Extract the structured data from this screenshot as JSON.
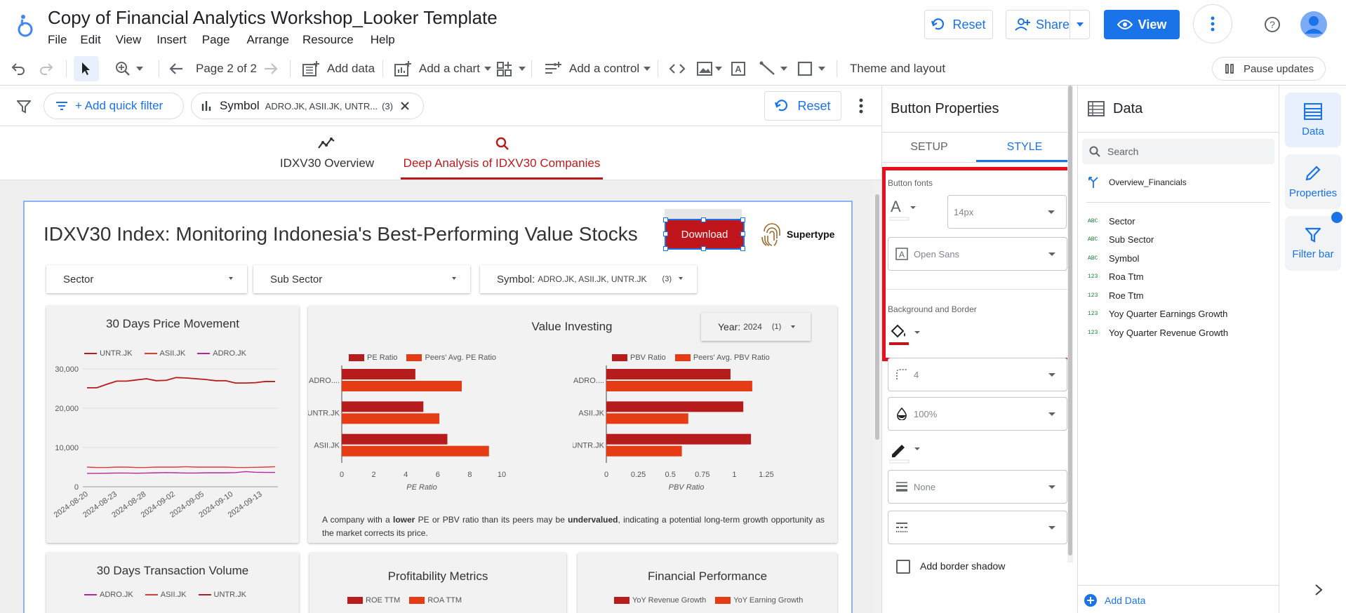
{
  "header": {
    "title": "Copy of Financial Analytics Workshop_Looker Template",
    "menu": [
      "File",
      "Edit",
      "View",
      "Insert",
      "Page",
      "Arrange",
      "Resource",
      "Help"
    ],
    "reset_label": "Reset",
    "share_label": "Share",
    "view_label": "View"
  },
  "toolbar": {
    "page_label": "Page 2 of 2",
    "add_data": "Add data",
    "add_chart": "Add a chart",
    "add_control": "Add a control",
    "theme": "Theme and layout",
    "pause": "Pause updates"
  },
  "filterbar": {
    "add_quick_filter": "+ Add quick filter",
    "chip_field": "Symbol",
    "chip_values": "ADRO.JK, ASII.JK, UNTR...",
    "chip_count": "(3)",
    "reset_label": "Reset"
  },
  "page_tabs": [
    {
      "label": "IDXV30 Overview",
      "active": false
    },
    {
      "label": "Deep Analysis of IDXV30 Companies",
      "active": true
    }
  ],
  "report": {
    "title": "IDXV30 Index: Monitoring Indonesia's Best-Performing Value Stocks",
    "download_label": "Download",
    "logo_text": "Supertype",
    "controls": {
      "sector": "Sector",
      "sub_sector": "Sub Sector",
      "symbol_label": "Symbol:",
      "symbol_values": "ADRO.JK, ASII.JK, UNTR.JK",
      "symbol_count": "(3)",
      "year_label": "Year:",
      "year_value": "2024",
      "year_count": "(1)"
    },
    "note_pre": "A company with a ",
    "note_b1": "lower",
    "note_mid": " PE or PBV ratio than its peers may be ",
    "note_b2": "undervalued",
    "note_post": ", indicating a potential long-term growth opportunity as the market corrects its price.",
    "bottom_cards": {
      "transaction_title": "30 Days Transaction Volume",
      "transaction_legend": [
        "ADRO.JK",
        "ASII.JK",
        "UNTR.JK"
      ],
      "profit_title": "Profitability Metrics",
      "profit_legend": [
        "ROE TTM",
        "ROA TTM"
      ],
      "fin_title": "Financial Performance",
      "fin_legend": [
        "YoY Revenue Growth",
        "YoY Earning Growth"
      ]
    }
  },
  "chart_data": [
    {
      "type": "line",
      "title": "30 Days Price Movement",
      "x": [
        "2024-08-20",
        "2024-08-23",
        "2024-08-28",
        "2024-09-02",
        "2024-09-05",
        "2024-09-10",
        "2024-09-13"
      ],
      "x_ticks": [
        "2024-08-20",
        "2024-08-23",
        "2024-08-28",
        "2024-09-02",
        "2024-09-05",
        "2024-09-10",
        "2024-09-13"
      ],
      "ylim": [
        0,
        30000
      ],
      "y_ticks": [
        "0",
        "10,000",
        "20,000",
        "30,000"
      ],
      "series": [
        {
          "name": "UNTR.JK",
          "color": "#b71c1c",
          "values": [
            25200,
            25200,
            26100,
            26900,
            26900,
            27200,
            27500,
            27000,
            27100,
            27800,
            27700,
            27500,
            27300,
            27000,
            27000,
            26400,
            26400,
            26500,
            26800,
            26800
          ]
        },
        {
          "name": "ASII.JK",
          "color": "#e53935",
          "values": [
            5000,
            4900,
            4900,
            5000,
            5000,
            4900,
            4900,
            5000,
            5000,
            5000,
            5100,
            5000,
            5000,
            5000,
            5000,
            4900,
            4900,
            4950,
            5000,
            5100
          ]
        },
        {
          "name": "ADRO.JK",
          "color": "#b5289c",
          "values": [
            3400,
            3400,
            3450,
            3500,
            3500,
            3450,
            3500,
            3550,
            3600,
            3550,
            3500,
            3500,
            3550,
            3550,
            3550,
            3600,
            3850,
            3700,
            3650,
            3650
          ]
        }
      ]
    },
    {
      "type": "bar",
      "title": "Value Investing",
      "orientation": "horizontal",
      "categories": [
        "ADRO....",
        "UNTR.JK",
        "ASII.JK"
      ],
      "xlabel": "PE Ratio",
      "xlim": [
        0,
        10
      ],
      "x_ticks": [
        "0",
        "2",
        "4",
        "6",
        "8",
        "10"
      ],
      "series": [
        {
          "name": "PE Ratio",
          "color": "#b71c1c",
          "values": [
            4.6,
            5.1,
            6.6
          ]
        },
        {
          "name": "Peers' Avg. PE Ratio",
          "color": "#e53c16",
          "values": [
            7.5,
            6.1,
            9.2
          ]
        }
      ]
    },
    {
      "type": "bar",
      "orientation": "horizontal",
      "categories": [
        "ADRO....",
        "ASII.JK",
        "UNTR.JK"
      ],
      "xlabel": "PBV Ratio",
      "xlim": [
        0,
        1.25
      ],
      "x_ticks": [
        "0",
        "0.25",
        "0.5",
        "0.75",
        "1",
        "1.25"
      ],
      "series": [
        {
          "name": "PBV Ratio",
          "color": "#b71c1c",
          "values": [
            0.97,
            1.07,
            1.13
          ]
        },
        {
          "name": "Peers' Avg. PBV Ratio",
          "color": "#e53c16",
          "values": [
            1.14,
            0.64,
            0.59
          ]
        }
      ]
    }
  ],
  "button_properties": {
    "title": "Button Properties",
    "tabs": [
      "SETUP",
      "STYLE"
    ],
    "fonts_label": "Button fonts",
    "font_size": "14px",
    "font_family": "Open Sans",
    "bg_label": "Background and Border",
    "radius": "4",
    "opacity": "100%",
    "border_style": "None",
    "shadow_label": "Add border shadow"
  },
  "data_panel": {
    "title": "Data",
    "search_placeholder": "Search",
    "source": "Overview_Financials",
    "fields": [
      {
        "type": "ABC",
        "name": "Sector"
      },
      {
        "type": "ABC",
        "name": "Sub Sector"
      },
      {
        "type": "ABC",
        "name": "Symbol"
      },
      {
        "type": "123",
        "name": "Roa Ttm"
      },
      {
        "type": "123",
        "name": "Roe Ttm"
      },
      {
        "type": "123",
        "name": "Yoy Quarter Earnings Growth"
      },
      {
        "type": "123",
        "name": "Yoy Quarter Revenue Growth"
      }
    ],
    "add_data": "Add Data"
  },
  "right_rail": {
    "data": "Data",
    "properties": "Properties",
    "filter_bar": "Filter bar"
  }
}
